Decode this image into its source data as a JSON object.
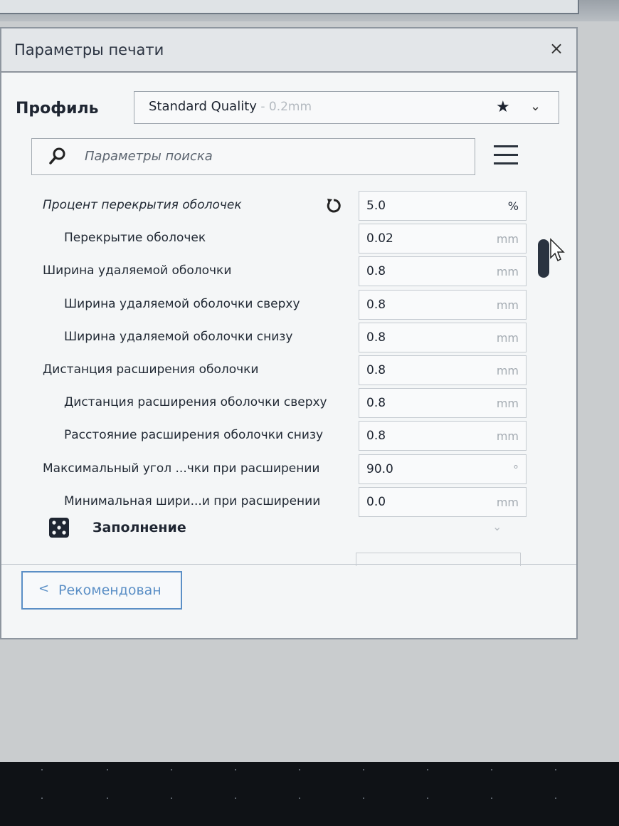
{
  "window": {
    "title": "Параметры печати",
    "close_glyph": "×"
  },
  "profile": {
    "label": "Профиль",
    "name": "Standard Quality",
    "suffix": " - 0.2mm",
    "favorite_glyph": "★",
    "dropdown_glyph": "⌄"
  },
  "search": {
    "placeholder": "Параметры поиска"
  },
  "settings": [
    {
      "label": "Процент перекрытия оболочек",
      "value": "5.0",
      "unit": "%",
      "italic": true,
      "has_reset": true,
      "indent": 0
    },
    {
      "label": "Перекрытие оболочек",
      "value": "0.02",
      "unit": "mm",
      "italic": false,
      "has_reset": false,
      "indent": 1
    },
    {
      "label": "Ширина удаляемой оболочки",
      "value": "0.8",
      "unit": "mm",
      "italic": false,
      "has_reset": false,
      "indent": 0
    },
    {
      "label": "Ширина удаляемой оболочки сверху",
      "value": "0.8",
      "unit": "mm",
      "italic": false,
      "has_reset": false,
      "indent": 1
    },
    {
      "label": "Ширина удаляемой оболочки снизу",
      "value": "0.8",
      "unit": "mm",
      "italic": false,
      "has_reset": false,
      "indent": 1
    },
    {
      "label": "Дистанция расширения оболочки",
      "value": "0.8",
      "unit": "mm",
      "italic": false,
      "has_reset": false,
      "indent": 0
    },
    {
      "label": "Дистанция расширения оболочки сверху",
      "value": "0.8",
      "unit": "mm",
      "italic": false,
      "has_reset": false,
      "indent": 1
    },
    {
      "label": "Расстояние расширения оболочки снизу",
      "value": "0.8",
      "unit": "mm",
      "italic": false,
      "has_reset": false,
      "indent": 1
    },
    {
      "label": "Максимальный угол ...чки при расширении",
      "value": "90.0",
      "unit": "°",
      "italic": false,
      "has_reset": false,
      "indent": 0
    },
    {
      "label": "Минимальная шири...и при расширении",
      "value": "0.0",
      "unit": "mm",
      "italic": false,
      "has_reset": false,
      "indent": 1
    }
  ],
  "section": {
    "title": "Заполнение",
    "icon": "infill-icon",
    "chevron_glyph": "⌄"
  },
  "recommended_button": {
    "chevron_glyph": "<",
    "label": "Рекомендован"
  },
  "icons": {
    "search": "search-icon",
    "menu": "hamburger-menu-icon",
    "reset": "reset-icon",
    "cursor": "mouse-cursor-icon"
  },
  "colors": {
    "accent": "#5b8fc6",
    "unit_text": "#a4abb2",
    "scrollbar": "#2a3340"
  }
}
